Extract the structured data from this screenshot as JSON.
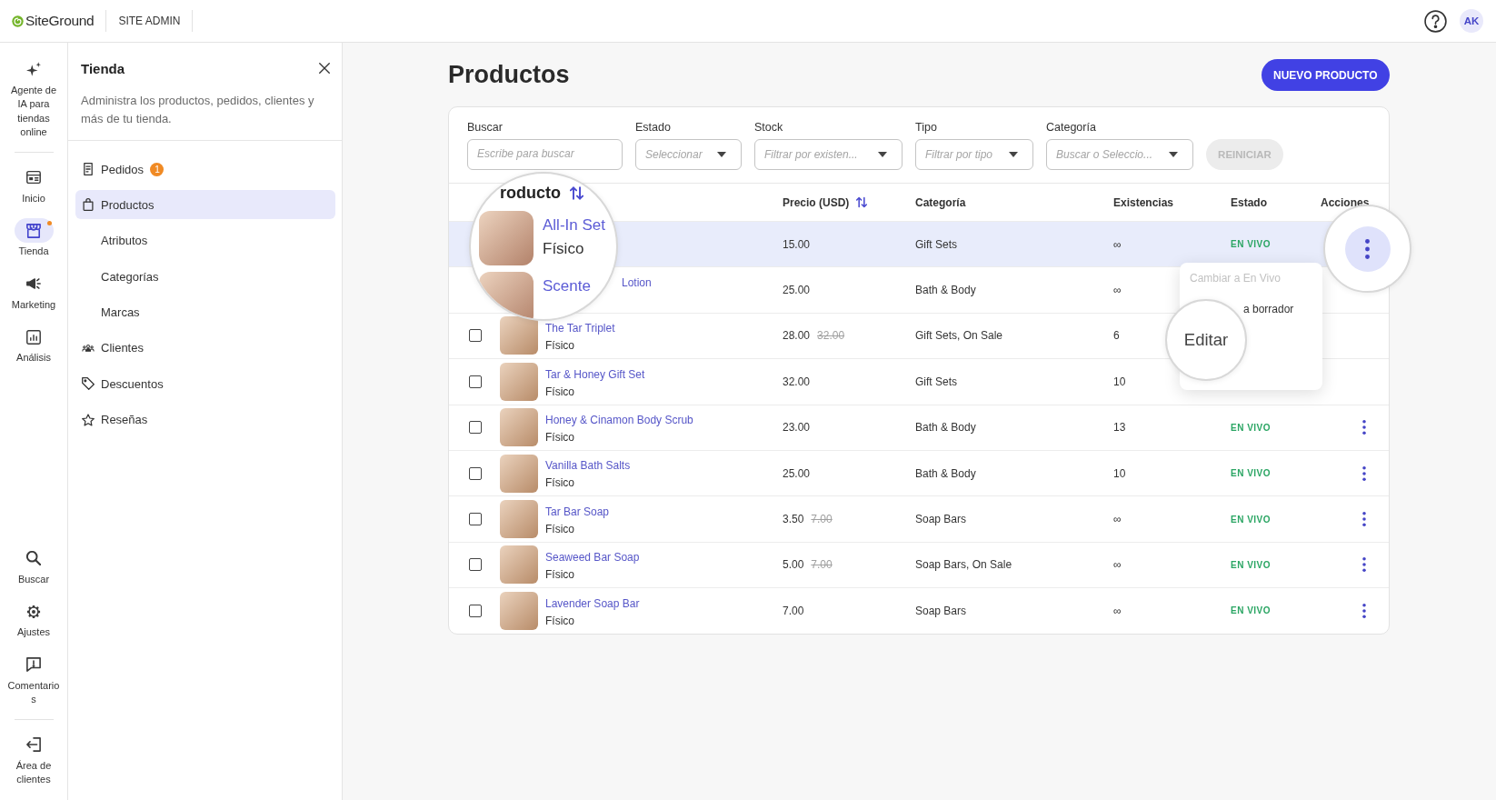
{
  "topbar": {
    "logo": "SiteGround",
    "section": "SITE ADMIN",
    "avatar": "AK"
  },
  "rail": {
    "top": [
      [
        {
          "label": "Agente de IA para tiendas online",
          "kind": "sparkle",
          "selected": false,
          "dot": false
        }
      ],
      [
        {
          "label": "Inicio",
          "kind": "dashboard",
          "selected": false,
          "dot": false
        },
        {
          "label": "Tienda",
          "kind": "store",
          "selected": true,
          "dot": true
        },
        {
          "label": "Marketing",
          "kind": "megaphone",
          "selected": false,
          "dot": false
        },
        {
          "label": "Análisis",
          "kind": "chart",
          "selected": false,
          "dot": false
        }
      ]
    ],
    "bottom": [
      [
        {
          "label": "Buscar",
          "kind": "search",
          "selected": false,
          "dot": false
        },
        {
          "label": "Ajustes",
          "kind": "gear",
          "selected": false,
          "dot": false
        },
        {
          "label": "Comentarios",
          "kind": "feedback",
          "selected": false,
          "dot": false
        }
      ],
      [
        {
          "label": "Área de clientes",
          "kind": "exit",
          "selected": false,
          "dot": false
        }
      ]
    ]
  },
  "sidebar": {
    "title": "Tienda",
    "description": "Administra los productos, pedidos, clientes y más de tu tienda.",
    "items": [
      {
        "label": "Pedidos",
        "kind": "orders",
        "badge": "1",
        "selected": false
      },
      {
        "label": "Productos",
        "kind": "bag",
        "selected": true,
        "children": [
          {
            "label": "Atributos",
            "selected": false
          },
          {
            "label": "Categorías",
            "selected": false
          },
          {
            "label": "Marcas",
            "selected": false
          }
        ]
      },
      {
        "label": "Clientes",
        "kind": "people",
        "selected": false
      },
      {
        "label": "Descuentos",
        "kind": "tag",
        "selected": false
      },
      {
        "label": "Reseñas",
        "kind": "star",
        "selected": false
      }
    ]
  },
  "page": {
    "title": "Productos",
    "new_button": "NUEVO PRODUCTO"
  },
  "filters": {
    "fields": [
      {
        "label": "Buscar",
        "kind": "text",
        "placeholder": "Escribe para buscar"
      },
      {
        "label": "Estado",
        "kind": "select",
        "placeholder": "Seleccionar"
      },
      {
        "label": "Stock",
        "kind": "select",
        "placeholder": "Filtrar por existen..."
      },
      {
        "label": "Tipo",
        "kind": "select",
        "placeholder": "Filtrar por tipo"
      },
      {
        "label": "Categoría",
        "kind": "select",
        "placeholder": "Buscar o Seleccio..."
      }
    ],
    "reset_button": {
      "label": "REINICIAR",
      "disabled": true
    }
  },
  "table": {
    "columns": [
      {
        "label": "Precio (USD)",
        "sortable": true
      },
      {
        "label": "Categoría",
        "sortable": false
      },
      {
        "label": "Existencias",
        "sortable": false
      },
      {
        "label": "Estado",
        "sortable": false
      },
      {
        "label": "Acciones",
        "sortable": false
      }
    ],
    "rows": [
      {
        "kind": "magnified",
        "selected": true,
        "price": "15.00",
        "category": "Gift Sets",
        "stock": "∞",
        "status": "EN VIVO",
        "actions_button": {
          "kind": "magnified"
        }
      },
      {
        "kind": "under_lens",
        "selected": false,
        "name": "Lotion",
        "price": "25.00",
        "category": "Bath & Body",
        "stock": "∞"
      },
      {
        "kind": "full",
        "selected": false,
        "checked": false,
        "name": "The Tar Triplet",
        "type": "Físico",
        "price": "28.00",
        "old_price": "32.00",
        "category": "Gift Sets, On Sale",
        "stock": "6"
      },
      {
        "kind": "full",
        "selected": false,
        "checked": false,
        "name": "Tar & Honey Gift Set",
        "type": "Físico",
        "price": "32.00",
        "category": "Gift Sets",
        "stock": "10"
      },
      {
        "kind": "full",
        "selected": false,
        "checked": false,
        "name": "Honey & Cinamon Body Scrub",
        "type": "Físico",
        "price": "23.00",
        "category": "Bath & Body",
        "stock": "13",
        "status": "EN VIVO",
        "actions_button": {
          "kind": "kebab"
        }
      },
      {
        "kind": "full",
        "selected": false,
        "checked": false,
        "name": "Vanilla Bath Salts",
        "type": "Físico",
        "price": "25.00",
        "category": "Bath & Body",
        "stock": "10",
        "status": "EN VIVO",
        "actions_button": {
          "kind": "kebab"
        }
      },
      {
        "kind": "full",
        "selected": false,
        "checked": false,
        "name": "Tar Bar Soap",
        "type": "Físico",
        "price": "3.50",
        "old_price": "7.00",
        "category": "Soap Bars",
        "stock": "∞",
        "status": "EN VIVO",
        "actions_button": {
          "kind": "kebab"
        }
      },
      {
        "kind": "full",
        "selected": false,
        "checked": false,
        "name": "Seaweed Bar Soap",
        "type": "Físico",
        "price": "5.00",
        "old_price": "7.00",
        "category": "Soap Bars, On Sale",
        "stock": "∞",
        "status": "EN VIVO",
        "actions_button": {
          "kind": "kebab"
        }
      },
      {
        "kind": "full",
        "selected": false,
        "checked": false,
        "name": "Lavender Soap Bar",
        "type": "Físico",
        "price": "7.00",
        "category": "Soap Bars",
        "stock": "∞",
        "status": "EN VIVO",
        "actions_button": {
          "kind": "kebab"
        }
      }
    ]
  },
  "product_lens": {
    "header": "roducto",
    "sortable": true,
    "rows": [
      {
        "name": "All-In Set",
        "type": "Físico"
      },
      {
        "name": "Scente"
      }
    ]
  },
  "row_menu": {
    "items": [
      {
        "label": "Cambiar a En Vivo",
        "kind": "plain",
        "disabled": true
      },
      {
        "label": "a borrador",
        "kind": "under_lens",
        "disabled": false
      },
      {
        "label": "Editar",
        "kind": "magnified",
        "disabled": false
      }
    ]
  }
}
